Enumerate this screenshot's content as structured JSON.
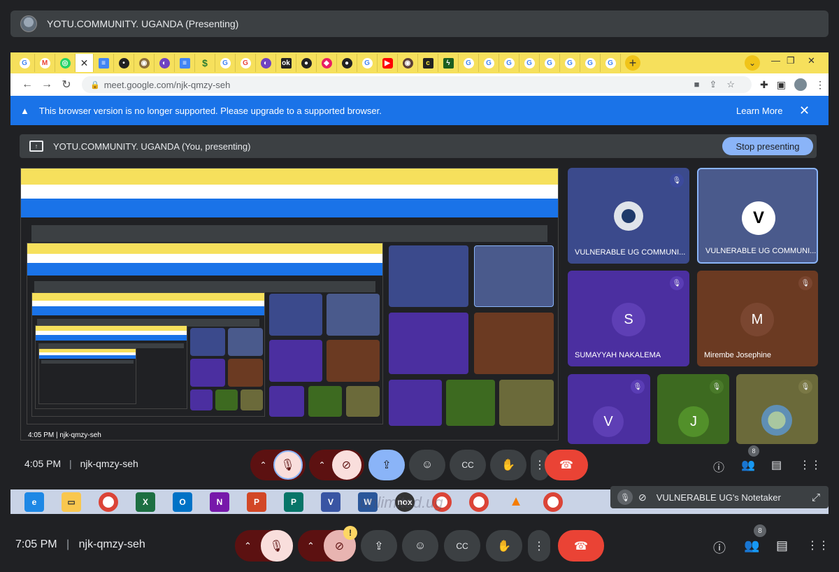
{
  "outer_bar": {
    "title": "YOTU.COMMUNITY. UGANDA (Presenting)"
  },
  "browser": {
    "url": "meet.google.com/njk-qmzy-seh",
    "tabs": [
      "G",
      "M",
      "W",
      "active",
      "doc",
      "live",
      "chrome",
      "purple",
      "doc",
      "s",
      "G",
      "G",
      "purple",
      "ok",
      "git",
      "pink",
      "git",
      "G",
      "yt",
      "globe",
      "c",
      "bolt",
      "G",
      "G",
      "G",
      "G",
      "G",
      "G",
      "G",
      "G"
    ]
  },
  "banner": {
    "message": "This browser version is no longer supported. Please upgrade to a supported browser.",
    "learn_more": "Learn More"
  },
  "presenting_bar": {
    "title": "YOTU.COMMUNITY. UGANDA (You, presenting)",
    "stop_label": "Stop presenting"
  },
  "tiles": [
    {
      "name": "VULNERABLE UG COMMUNI...",
      "kind": "avatar-photo",
      "bg": "#3b4a8c"
    },
    {
      "name": "VULNERABLE UG COMMUNI...",
      "kind": "logo",
      "bg": "#4a5a8c"
    },
    {
      "name": "SUMAYYAH NAKALEMA",
      "letter": "S",
      "bg": "#4b2fa0",
      "circle": "#5e3fb5"
    },
    {
      "name": "Mirembe Josephine",
      "letter": "M",
      "bg": "#6b3a22",
      "circle": "#7a4630"
    },
    {
      "letter": "V",
      "bg": "#4b2fa0",
      "circle": "#5e3fb5"
    },
    {
      "letter": "J",
      "bg": "#3d6a20",
      "circle": "#52902a"
    },
    {
      "kind": "photo",
      "bg": "#6b6a3a"
    }
  ],
  "inner_controls": {
    "time": "4:05 PM",
    "meeting_code": "njk-qmzy-seh",
    "people_count": "8"
  },
  "notetaker": {
    "label": "VULNERABLE UG's Notetaker"
  },
  "taskbar": {
    "watermark": "unlimited.ug",
    "apps": [
      "e",
      "folder",
      "chrome",
      "X",
      "O",
      "N",
      "P",
      "P",
      "V",
      "W",
      "nox",
      "chrome",
      "chrome",
      "vlc",
      "chrome"
    ]
  },
  "outer_controls": {
    "time": "7:05 PM",
    "meeting_code": "njk-qmzy-seh",
    "people_count": "8",
    "warning_badge": "!"
  },
  "recursion_thumb": {
    "time": "4:05 PM",
    "meeting_code": "njk-qmzy-seh",
    "people_count": "8"
  },
  "colors": {
    "end_call": "#ea4335",
    "mic_off_bg": "#f9dedc",
    "stop_presenting": "#8ab4f8",
    "banner": "#1a73e8"
  }
}
